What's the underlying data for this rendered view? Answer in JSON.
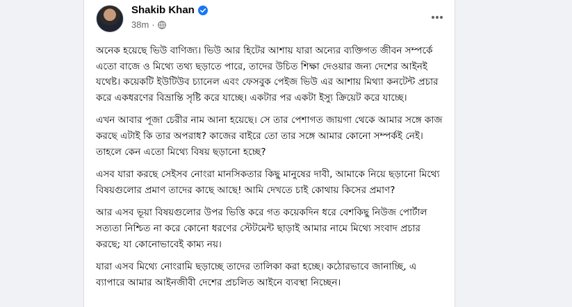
{
  "post": {
    "author": "Shakib Khan",
    "timestamp": "38m",
    "separator": "·",
    "privacy_icon": "globe-icon",
    "verified_icon": "verified-badge-icon",
    "more_icon": "more-horizontal-icon",
    "paragraphs": [
      "অনেক হয়েছে ভিউ বাণিজ্য। ভিউ আর হিটের আশায় যারা অন্যের ব্যক্তিগত জীবন সম্পর্কে এতো বাজে ও মিথ্যে তথ্য ছড়াতে পারে, তাদের উচিত শিক্ষা দেওয়ার জন্য দেশের আইনই যথেষ্ট। কয়েকটি ইউটিউব চ্যানেল এবং ফেসবুক পেইজ ভিউ এর আশায় মিথ্যা কনটেন্ট প্রচার করে একধরণের বিভ্রান্তি সৃষ্টি করে যাচ্ছে। একটার পর একটা ইস্যু ক্রিয়েট করে যাচ্ছে।",
      "এখন আবার পূজা চেরীর নাম আনা হয়েছে। সে তার পেশাগত জায়গা থেকে আমার সঙ্গে কাজ করছে এটাই কি তার অপরাধ? কাজের বাইরে তো তার সঙ্গে আমার কোনো সম্পর্কই নেই। তাহলে কেন এতো মিথ্যে বিষয় ছড়ানো হচ্ছে?",
      "এসব যারা করছে সেইসব নোংরা মানসিকতার কিছু মানুষের দাবী, আমাকে নিয়ে ছড়ানো মিথ্যে বিষয়গুলোর প্রমাণ তাদের কাছে আছে! আমি দেখতে চাই কোথায় কিসের প্রমাণ?",
      "আর এসব ভূয়া বিষয়গুলোর উপর ভিত্তি করে গত কয়েকদিন ধরে বেশকিছু নিউজ পোর্টাল সত্যতা নিশ্চিত না করে কোনো ধরণের স্টেটমেন্ট ছাড়াই আমার নামে মিথ্যে সংবাদ প্রচার করছে; যা কোনোভাবেই কাম্য নয়।",
      "যারা এসব মিথ্যে নোংরামি ছড়াচ্ছে তাদের তালিকা করা হচ্ছে। কঠোরভাবে জানাচ্ছি, এ ব্যাপারে আমার আইনজীবী দেশের প্রচলিত আইনে ব্যবস্থা নিচ্ছেন।"
    ]
  },
  "colors": {
    "page_background": "#f0f2f5",
    "card_background": "#ffffff",
    "verified_blue": "#1877f2",
    "secondary_text": "#65676b",
    "primary_text": "#050505"
  }
}
